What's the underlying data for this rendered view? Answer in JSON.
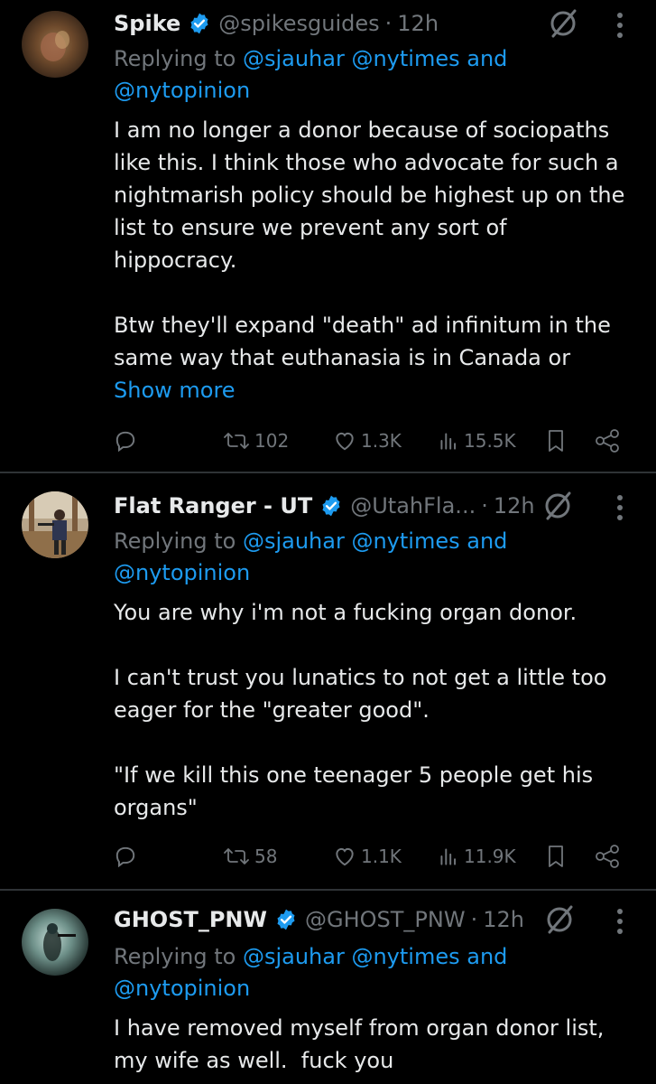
{
  "tweets": [
    {
      "name": "Spike",
      "handle": "@spikesguides",
      "time": "12h",
      "replying_prefix": "Replying to",
      "mentions_line1": [
        "@sjauhar",
        "@nytimes"
      ],
      "and_word": "and",
      "mention_line2": "@nytopinion",
      "paragraphs": [
        [
          "I am no longer a donor because of sociopaths",
          "like this. I think those who advocate for such a",
          "nightmarish policy should be highest up on the",
          "list to ensure we prevent any sort of",
          "hippocracy."
        ],
        [
          "Btw they'll expand \"death\" ad infinitum in the",
          "same way that euthanasia is in Canada or"
        ]
      ],
      "show_more": "Show more",
      "retweets": "102",
      "likes": "1.3K",
      "views": "15.5K"
    },
    {
      "name": "Flat Ranger - UT",
      "handle": "@UtahFla...",
      "time": "12h",
      "replying_prefix": "Replying to",
      "mentions_line1": [
        "@sjauhar",
        "@nytimes"
      ],
      "and_word": "and",
      "mention_line2": "@nytopinion",
      "paragraphs": [
        [
          "You are why i'm not a fucking organ donor."
        ],
        [
          "I can't trust you lunatics to not get a little too",
          "eager for the \"greater good\"."
        ],
        [
          "\"If we kill this one teenager 5 people get his",
          "organs\""
        ]
      ],
      "retweets": "58",
      "likes": "1.1K",
      "views": "11.9K"
    },
    {
      "name": "GHOST_PNW",
      "handle": "@GHOST_PNW",
      "time": "12h",
      "replying_prefix": "Replying to",
      "mentions_line1": [
        "@sjauhar",
        "@nytimes"
      ],
      "and_word": "and",
      "mention_line2": "@nytopinion",
      "paragraphs": [
        [
          "I have removed myself from organ donor list,",
          "my wife as well.  fuck you"
        ]
      ]
    }
  ],
  "colors": {
    "background": "#000000",
    "text": "#e7e9ea",
    "muted": "#71767b",
    "accent": "#1d9bf0",
    "divider": "#2f3336"
  },
  "icons": [
    "verified-badge-icon",
    "grok-icon",
    "more-options-icon",
    "reply-icon",
    "retweet-icon",
    "like-icon",
    "views-icon",
    "bookmark-icon",
    "share-icon"
  ]
}
